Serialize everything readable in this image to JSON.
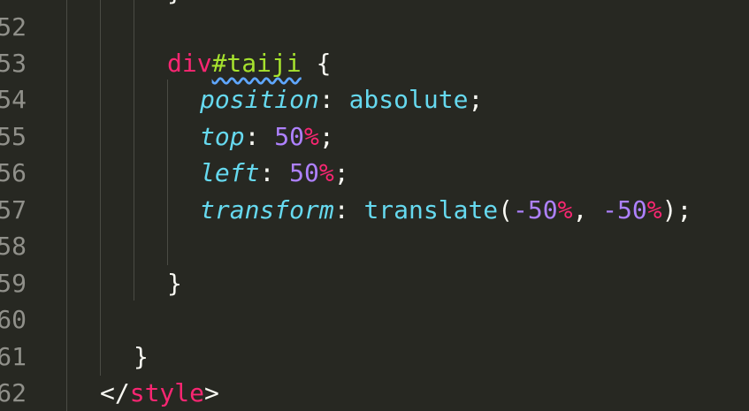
{
  "editor": {
    "lines": [
      {
        "no": "52",
        "code": ""
      },
      {
        "no": "53",
        "tag": "div",
        "id": "#taiji",
        "brace": " {"
      },
      {
        "no": "54",
        "prop": "position",
        "colon": ": ",
        "value": "absolute",
        "semi": ";"
      },
      {
        "no": "55",
        "prop": "top",
        "colon": ": ",
        "num": "50",
        "unit": "%",
        "semi": ";"
      },
      {
        "no": "56",
        "prop": "left",
        "colon": ": ",
        "num": "50",
        "unit": "%",
        "semi": ";"
      },
      {
        "no": "57",
        "prop": "transform",
        "colon": ": ",
        "func": "translate",
        "open": "(",
        "num1": "-50",
        "unit1": "%",
        "sep": ", ",
        "num2": "-50",
        "unit2": "%",
        "close": ")",
        "semi": ";"
      },
      {
        "no": "58",
        "code": ""
      },
      {
        "no": "59",
        "code": "}"
      },
      {
        "no": "60",
        "code": ""
      },
      {
        "no": "61",
        "code": "}"
      },
      {
        "no": "62",
        "open_tag": "</",
        "tagname": "style",
        "close_tag": ">"
      }
    ],
    "top_fragment": "}"
  }
}
